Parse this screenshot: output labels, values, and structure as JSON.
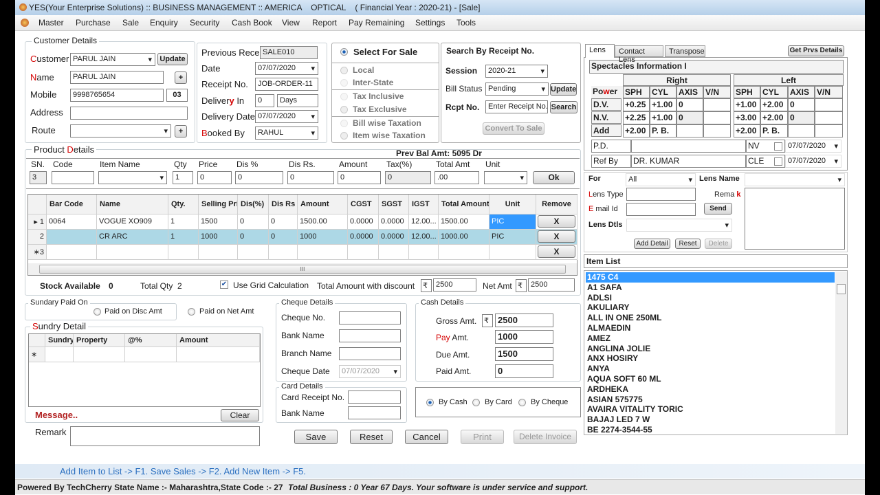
{
  "window": {
    "title": "YES(Your Enterprise Solutions) :: BUSINESS MANAGEMENT :: AMERICA    OPTICAL    ( Financial Year : 2020-21) - [Sale]"
  },
  "menu": [
    "Master",
    "Purchase",
    "Sale",
    "Enquiry",
    "Security",
    "Cash Book",
    "View",
    "Report",
    "Pay Remaining",
    "Settings",
    "Tools"
  ],
  "customer": {
    "legend": "Customer Details",
    "customer_label": "Customer",
    "customer_value": "PARUL JAIN",
    "update": "Update",
    "name_label": "Name",
    "name_value": "PARUL JAIN",
    "plus": "+",
    "mobile_label": "Mobile",
    "mobile_value": "9998765654",
    "mobile_code": "03",
    "address_label": "Address",
    "address_value": "",
    "route_label": "Route",
    "route_value": ""
  },
  "receipt": {
    "prev_label": "Previous Rece.",
    "prev_value": "SALE010",
    "date_label": "Date",
    "date_value": "07/07/2020",
    "receipt_label": "Receipt No.",
    "receipt_value": "JOB-ORDER-11",
    "delivery_pre": "Deliver",
    "delivery_red": "y",
    "delivery_post": " In",
    "delivery_value": "0",
    "delivery_unit": "Days",
    "delivery_date_label": "Delivery Date",
    "delivery_date_value": "07/07/2020",
    "booked_label": "Booked By",
    "booked_value": "RAHUL"
  },
  "sale_options": {
    "select_for_sale": "Select For Sale",
    "local": "Local",
    "inter_state": "Inter-State",
    "tax_inclusive": "Tax Inclusive",
    "tax_exclusive": "Tax Exclusive",
    "bill_wise": "Bill wise Taxation",
    "item_wise": "Item wise Taxation"
  },
  "search": {
    "title": "Search By Receipt No.",
    "session_label": "Session",
    "session_value": "2020-21",
    "bill_status_label": "Bill Status",
    "bill_status_value": "Pending",
    "update": "Update",
    "rcpt_label": "Rcpt No.",
    "rcpt_placeholder": "Enter Receipt No.",
    "search": "Search",
    "convert": "Convert To Sale"
  },
  "product": {
    "legend_pre": "Product ",
    "legend_red": "D",
    "legend_post": "etails",
    "prev_bal": "Prev Bal Amt: 5095 Dr",
    "entry_headers": [
      "SN.",
      "Code",
      "Item Name",
      "Qty",
      "Price",
      "Dis %",
      "Dis Rs.",
      "Amount",
      "Tax(%)",
      "Total Amt",
      "Unit"
    ],
    "entry_values": [
      "3",
      "",
      "",
      "1",
      "0",
      "0",
      "0",
      "0",
      "0",
      ".00",
      ""
    ],
    "ok": "Ok",
    "grid_headers": [
      "",
      "Bar Code",
      "Name",
      "Qty.",
      "Selling Price",
      "Dis(%)",
      "Dis Rs",
      "Amount",
      "CGST",
      "SGST",
      "IGST",
      "Total Amount",
      "Unit",
      "Remove"
    ],
    "grid_rows": [
      [
        "▸ 1",
        "0064",
        "VOGUE XO909",
        "1",
        "1500",
        "0",
        "0",
        "1500.00",
        "0.0000",
        "0.0000",
        "12.00...",
        "1500.00",
        "PIC",
        "X"
      ],
      [
        "2",
        "",
        "CR ARC",
        "1",
        "1000",
        "0",
        "0",
        "1000",
        "0.0000",
        "0.0000",
        "12.00...",
        "1000.00",
        "PIC",
        "X"
      ],
      [
        "∗3",
        "",
        "",
        "",
        "",
        "",
        "",
        "",
        "",
        "",
        "",
        "",
        "",
        "X"
      ]
    ],
    "scroll_grip": "III",
    "stock_label": "Stock Available",
    "stock_value": "0",
    "total_qty_label": "Total Qty",
    "total_qty_value": "2",
    "use_grid": "Use Grid Calculation",
    "total_discount_label": "Total Amount with discount",
    "rupee": "₹",
    "total_discount_value": "2500",
    "net_label": "Net Amt",
    "net_value": "2500"
  },
  "sundry": {
    "paid_on_legend": "Sundary Paid On",
    "paid_disc": "Paid on Disc Amt",
    "paid_net": "Paid on Net Amt",
    "detail_legend": "Sundry Detail",
    "headers": [
      "",
      "Sundry",
      "Property",
      "@%",
      "Amount"
    ],
    "new_row_marker": "∗",
    "message": "Message..",
    "clear": "Clear",
    "remark_label": "Remark"
  },
  "cheque": {
    "legend": "Cheque Details",
    "no_label": "Cheque No.",
    "bank_label": "Bank Name",
    "branch_label": "Branch Name",
    "date_label": "Cheque Date",
    "date_value": "07/07/2020"
  },
  "card": {
    "legend": "Card Details",
    "receipt_label": "Card Receipt No.",
    "bank_label": "Bank Name"
  },
  "cash": {
    "legend": "Cash Details",
    "gross_label": "Gross Amt.",
    "gross_value": "2500",
    "pay_red": "Pay",
    "pay_post": " Amt.",
    "pay_value": "1000",
    "due_label": "Due Amt.",
    "due_value": "1500",
    "paid_label": "Paid Amt.",
    "paid_value": "0",
    "by_cash": "By Cash",
    "by_card": "By Card",
    "by_cheque": "By Cheque"
  },
  "actions": {
    "save": "Save",
    "reset": "Reset",
    "cancel": "Cancel",
    "print": "Print",
    "delete": "Delete Invoice"
  },
  "hint": "Add Item to List -> F1. Save Sales -> F2. Add New Item -> F5.",
  "status": {
    "powered": "Powered By TechCherry  State Name :- Maharashtra,State Code :- 27",
    "business": "Total Business : 0 Year 67 Days.  Your software is under service and support."
  },
  "lens_panel": {
    "tabs": [
      "Lens",
      "Contact Lens",
      "Transpose"
    ],
    "get_prvs": "Get Prvs  Details",
    "spec_title": "Spectacles Information I",
    "right": "Right",
    "left": "Left",
    "power_pre": "Po",
    "power_red": "w",
    "power_post": "er",
    "col_headers": [
      "SPH",
      "CYL",
      "AXIS",
      "V/N",
      "SPH",
      "CYL",
      "AXIS",
      "V/N"
    ],
    "rows": [
      {
        "label": "D.V.",
        "values": [
          "+0.25",
          "+1.00",
          "0",
          "",
          "+1.00",
          "+2.00",
          "0",
          ""
        ]
      },
      {
        "label": "N.V.",
        "values": [
          "+2.25",
          "+1.00",
          "0",
          "",
          "+3.00",
          "+2.00",
          "0",
          ""
        ]
      },
      {
        "label": "Add",
        "values": [
          "+2.00",
          "P. B.",
          "",
          "",
          "+2.00",
          "P. B.",
          "",
          ""
        ]
      }
    ],
    "pd_label": "P.D.",
    "pd_value": "",
    "nv_label": "NV",
    "nv_date": "07/07/2020",
    "ref_label": "Ref By",
    "ref_value": "DR. KUMAR",
    "cle_label": "CLE",
    "cle_date": "07/07/2020",
    "for_label": "For",
    "for_value": "All",
    "lens_name_label": "Lens Name",
    "lens_type_label": "Lens Type",
    "remark_pre": "Rema ",
    "remark_red": "k",
    "email_label": "E mail Id",
    "send": "Send",
    "lens_dtls_label": "Lens Dtls",
    "add_detail": "Add Detail",
    "reset": "Reset",
    "delete": "Delete"
  },
  "item_list": {
    "title": "Item List",
    "items": [
      "1475 C4",
      "A1 SAFA",
      "ADLSI",
      "AKULIARY",
      "ALL IN ONE 250ML",
      "ALMAEDIN",
      "AMEZ",
      "ANGLINA JOLIE",
      "ANX HOSIRY",
      "ANYA",
      "AQUA SOFT 60 ML",
      "ARDHEKA",
      "ASIAN 575775",
      "AVAIRA VITALITY TORIC",
      "BAJAJ LED 7 W",
      "BE 2274-3544-55"
    ]
  }
}
